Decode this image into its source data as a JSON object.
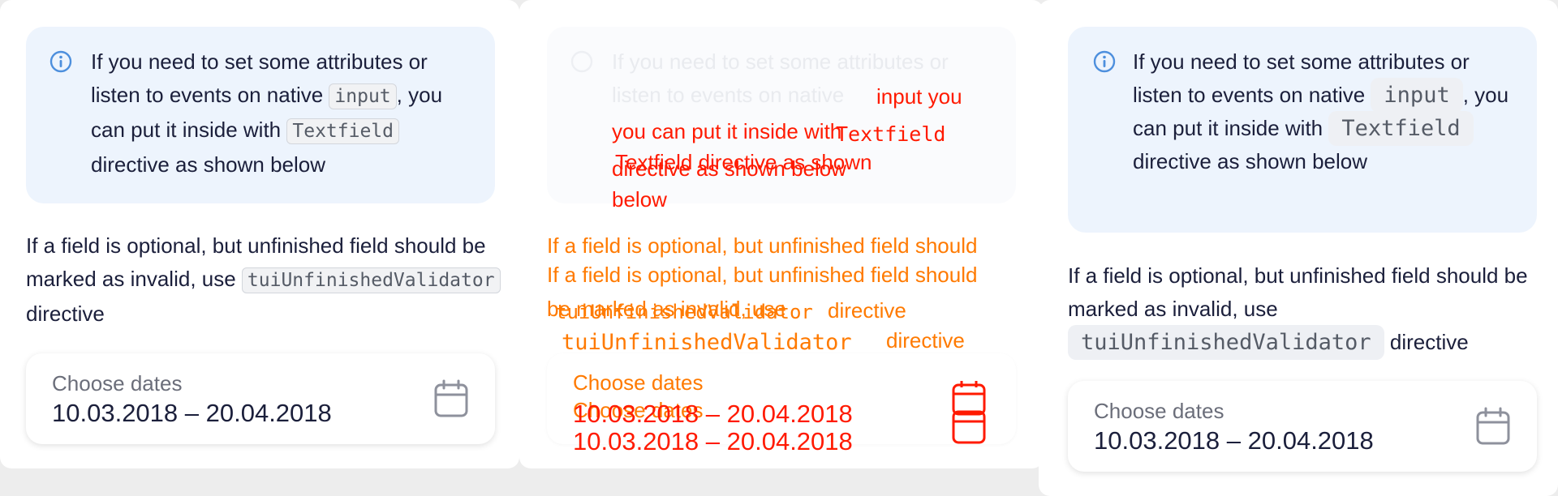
{
  "notification": {
    "part1": "If you need to set some attributes or listen to events on native",
    "code_input": "input",
    "part2": ", you can put it inside with",
    "code_textfield": "Textfield",
    "part3": "directive as shown below"
  },
  "paragraph": {
    "part1": "If a field is optional, but unfinished field should be marked as invalid, use",
    "code_validator": "tuiUnfinishedValidator",
    "part2": "directive"
  },
  "field": {
    "label": "Choose dates",
    "value": "10.03.2018 – 20.04.2018"
  },
  "middle": {
    "notif_line1": "If you need to set some attributes or",
    "notif_line2": "listen to events on native",
    "red_l1": "input you",
    "red_l2a": "you can put it inside with",
    "red_l2b": "Textfield",
    "red_l3": "Textfield directive as shown",
    "red_l4": "directive as shown below",
    "red_l5": "below",
    "para_l1": "If a field is optional, but unfinished field should",
    "para_l2": "If a field is optional, but unfinished field should",
    "para_l3": "be marked as invalid, use",
    "para_l4a": "tuiUnfinishedValidator",
    "para_l4b": "directive",
    "para_l5a": "tuiUnfinishedValidator",
    "para_l5b": "directive",
    "field_label_1": "Choose dates",
    "field_label_2": "Choose dates",
    "field_value_1": "10.03.2018 – 20.04.2018",
    "field_value_2": "10.03.2018 – 20.04.2018"
  },
  "icons": {
    "info": "info-icon",
    "calendar": "calendar-icon"
  },
  "colors": {
    "accent": "#4d8fdd",
    "notification_bg": "#edf4fd",
    "error_red": "#ff1a00",
    "error_orange": "#ff7a00"
  }
}
